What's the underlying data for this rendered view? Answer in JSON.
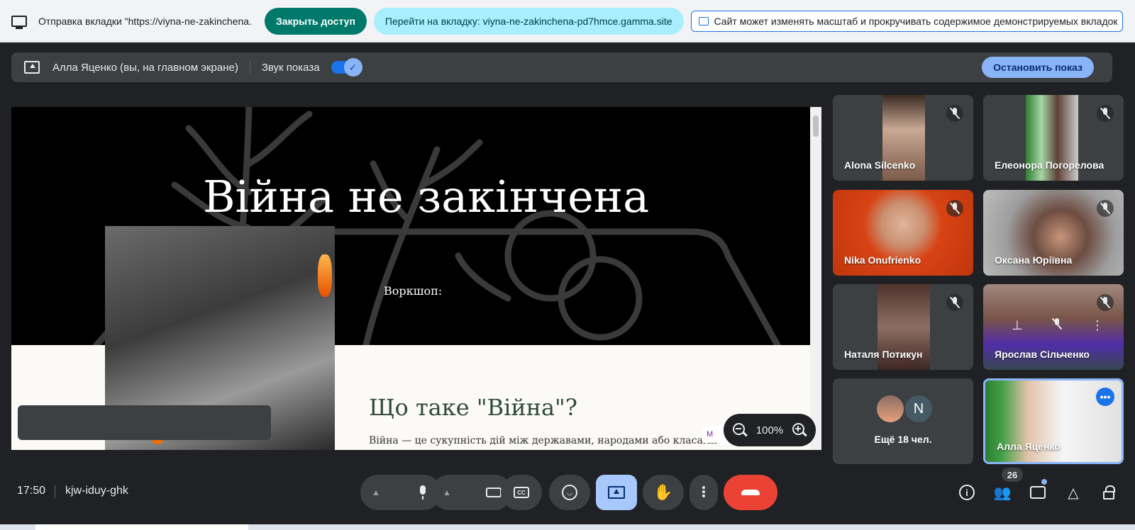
{
  "share_bar": {
    "text": "Отправка вкладки \"https://viyna-ne-zakinchena...",
    "close_access_label": "Закрыть доступ",
    "goto_tab_label": "Перейти на вкладку: viyna-ne-zakinchena-pd7hmce.gamma.site",
    "site_note": "Сайт может изменять масштаб и прокручивать содержимое демонстрируемых вкладок"
  },
  "present_bar": {
    "presenter": "Алла Яценко (вы, на главном экране)",
    "sound_label": "Звук показа",
    "sound_on": true,
    "stop_label": "Остановить показ"
  },
  "slide": {
    "title": "Війна не закінчена",
    "subtitle": "Воркшоп:",
    "heading": "Що таке \"Війна\"?",
    "paragraph": "Війна — це сукупність дій між державами, народами або класами",
    "badge": "M"
  },
  "zoom": {
    "value": "100%"
  },
  "participants": [
    {
      "name": "Alona Silcenko",
      "muted": true
    },
    {
      "name": "Елеонора Погорелова",
      "muted": true
    },
    {
      "name": "Nika Onufrienko",
      "muted": true
    },
    {
      "name": "Оксана Юріївна",
      "muted": true
    },
    {
      "name": "Наталя Потикун",
      "muted": true
    },
    {
      "name": "Ярослав Сільченко",
      "muted": true
    },
    {
      "name": "Алла Яценко",
      "muted": false
    }
  ],
  "more_tile": {
    "label": "Ещё 18 чел.",
    "avatar_letter": "N"
  },
  "bottom_bar": {
    "time": "17:50",
    "meeting_code": "kjw-iduy-ghk",
    "people_count": "26"
  },
  "colors": {
    "accent": "#8ab4f8",
    "hangup": "#ea4335",
    "close_access": "#00796b",
    "goto_tab": "#a8eefc",
    "slide_heading": "#2e4a36"
  }
}
